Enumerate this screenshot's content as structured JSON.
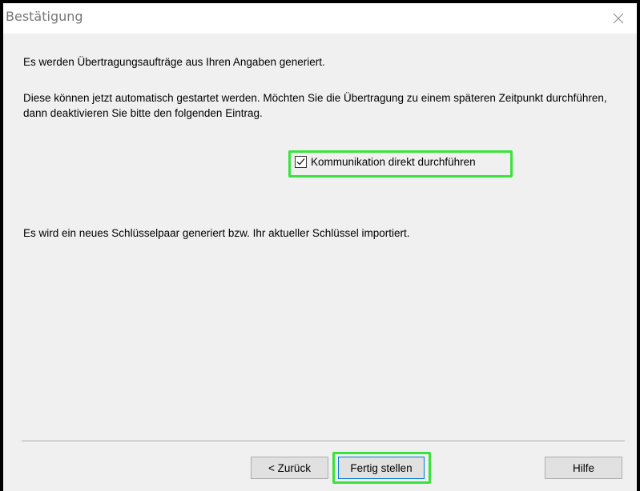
{
  "window": {
    "title": "Bestätigung",
    "close_icon": "close-icon"
  },
  "content": {
    "intro": "Es werden Übertragungsaufträge aus Ihren Angaben generiert.",
    "description": "Diese können jetzt automatisch gestartet werden. Möchten Sie die Übertragung zu einem späteren Zeitpunkt durchführen, dann deaktivieren Sie bitte den folgenden Eintrag.",
    "checkbox": {
      "label": "Kommunikation direkt durchführen",
      "checked": true
    },
    "keypair_text": "Es wird ein neues Schlüsselpaar generiert bzw. Ihr aktueller Schlüssel importiert."
  },
  "buttons": {
    "back": "< Zurück",
    "finish": "Fertig stellen",
    "help": "Hilfe"
  },
  "colors": {
    "highlight": "#39e33b",
    "dialog_bg": "#f0f0f0",
    "button_bg": "#e1e1e1",
    "default_button_border": "#0078d7"
  }
}
